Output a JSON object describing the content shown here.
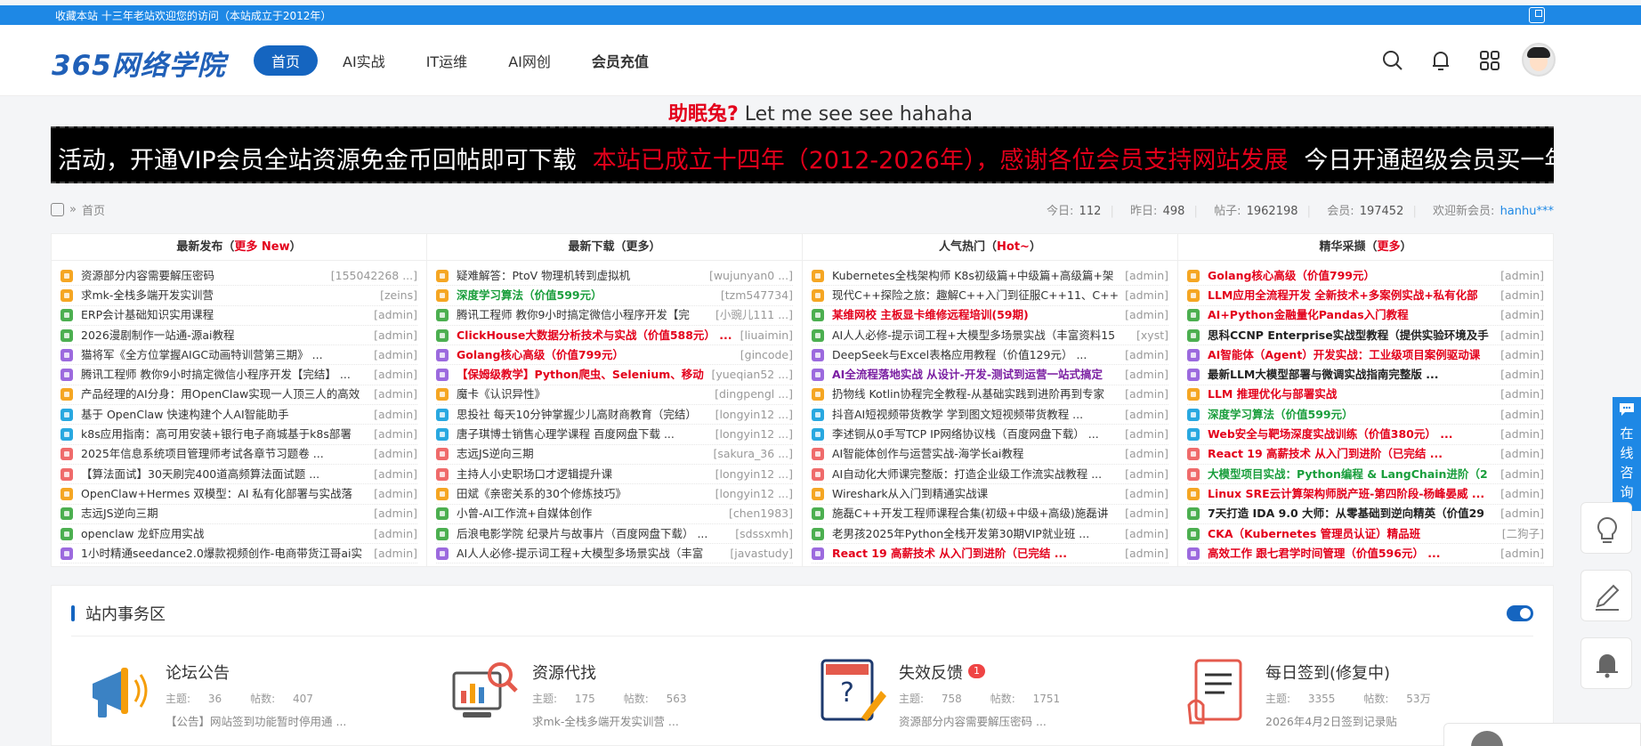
{
  "topbar": {
    "text": "收藏本站   十三年老站欢迎您的访问（本站成立于2012年）"
  },
  "header": {
    "logo": "365网络学院",
    "nav": [
      {
        "label": "首页"
      },
      {
        "label": "AI实战"
      },
      {
        "label": "IT运维"
      },
      {
        "label": "AI网创"
      },
      {
        "label": "会员充值"
      }
    ]
  },
  "slogan": {
    "red": "助眠兔?",
    "black": " Let me see see hahaha"
  },
  "marquee": {
    "part1": "活动，开通VIP会员全站资源免金币回帖即可下载",
    "part2": "本站已成立十四年（2012-2026年），感谢各位会员支持网站发展",
    "part3": "今日开通超级会员买一年送"
  },
  "crumb": {
    "home": "首页",
    "sep": "»"
  },
  "stats": {
    "today_label": "今日:",
    "today": "112",
    "yesterday_label": "昨日:",
    "yesterday": "498",
    "posts_label": "帖子:",
    "posts": "1962198",
    "members_label": "会员:",
    "members": "197452",
    "newuser_label": "欢迎新会员:",
    "newuser": "hanhu***"
  },
  "columns": [
    {
      "title": "最新发布（",
      "title_hl": "更多 New",
      "title_end": "）",
      "items": [
        {
          "t": "资源部分内容需要解压密码",
          "a": "[155042268 ...]",
          "style": ""
        },
        {
          "t": "求mk-全栈多端开发实训营",
          "a": "[zeins]",
          "style": ""
        },
        {
          "t": "ERP会计基础知识实用课程",
          "a": "[admin]",
          "style": ""
        },
        {
          "t": "2026漫剧制作一站通-源ai教程",
          "a": "[admin]",
          "style": ""
        },
        {
          "t": "猫将军《全方位掌握AIGC动画特训营第三期》 ...",
          "a": "[admin]",
          "style": ""
        },
        {
          "t": "腾讯工程师 教你9小时搞定微信小程序开发【完结】 ...",
          "a": "[admin]",
          "style": ""
        },
        {
          "t": "产品经理的AI分身：用OpenClaw实现一人顶三人的高效",
          "a": "[admin]",
          "style": ""
        },
        {
          "t": "基于 OpenClaw 快速构建个人AI智能助手",
          "a": "[admin]",
          "style": ""
        },
        {
          "t": "k8s应用指南：高可用安装+银行电子商城基于k8s部署",
          "a": "[admin]",
          "style": ""
        },
        {
          "t": "2025年信息系统项目管理师考试各章节习题卷 ...",
          "a": "[admin]",
          "style": ""
        },
        {
          "t": "【算法面试】30天刷完400道高频算法面试题 ...",
          "a": "[admin]",
          "style": ""
        },
        {
          "t": "OpenClaw+Hermes 双模型：AI 私有化部署与实战落",
          "a": "[admin]",
          "style": ""
        },
        {
          "t": "志远JS逆向三期",
          "a": "[admin]",
          "style": ""
        },
        {
          "t": "openclaw 龙虾应用实战",
          "a": "[admin]",
          "style": ""
        },
        {
          "t": "1小时精通seedance2.0爆款视频创作-电商带货江哥ai实",
          "a": "[admin]",
          "style": ""
        }
      ]
    },
    {
      "title": "最新下载（更多）",
      "title_hl": "",
      "title_end": "",
      "items": [
        {
          "t": "疑难解答：PtoV 物理机转到虚拟机",
          "a": "[wujunyan0 ...]",
          "style": ""
        },
        {
          "t": "深度学习算法（价值599元）",
          "a": "[tzm547734]",
          "style": "green"
        },
        {
          "t": "腾讯工程师 教你9小时搞定微信小程序开发【完",
          "a": "[小豌儿111 ...]",
          "style": ""
        },
        {
          "t": "ClickHouse大数据分析技术与实战（价值588元） ...",
          "a": "[liuaimin]",
          "style": "red"
        },
        {
          "t": "Golang核心高级（价值799元）",
          "a": "[gincode]",
          "style": "red"
        },
        {
          "t": "【保姆级教学】Python爬虫、Selenium、移动",
          "a": "[yueqian52 ...]",
          "style": "red"
        },
        {
          "t": "魔卡《认识异性》",
          "a": "[dingpengl ...]",
          "style": ""
        },
        {
          "t": "思投社 每天10分钟掌握少儿高财商教育（完结）",
          "a": "[longyin12 ...]",
          "style": ""
        },
        {
          "t": "唐子琪博士销售心理学课程 百度网盘下载 ...",
          "a": "[longyin12 ...]",
          "style": ""
        },
        {
          "t": "志远JS逆向三期",
          "a": "[sakura_36 ...]",
          "style": ""
        },
        {
          "t": "主持人小史职场口才逻辑提升课",
          "a": "[longyin12 ...]",
          "style": ""
        },
        {
          "t": "田斌《亲密关系的30个修炼技巧》",
          "a": "[longyin12 ...]",
          "style": ""
        },
        {
          "t": "小曾-AI工作流+自媒体创作",
          "a": "[chen1983]",
          "style": ""
        },
        {
          "t": "后浪电影学院 纪录片与故事片（百度网盘下载） ...",
          "a": "[sdssxmh]",
          "style": ""
        },
        {
          "t": "AI人人必修-提示词工程+大模型多场景实战（丰富",
          "a": "[javastudy]",
          "style": ""
        }
      ]
    },
    {
      "title": "人气热门（",
      "title_hl": "Hot~",
      "title_end": "）",
      "items": [
        {
          "t": "Kubernetes全栈架构师 K8s初级篇+中级篇+高级篇+架",
          "a": "[admin]",
          "style": ""
        },
        {
          "t": "现代C++探险之旅：趣解C++入门到征服C++11、C++",
          "a": "[admin]",
          "style": ""
        },
        {
          "t": "某维网校 主板显卡维修远程培训(59期)",
          "a": "[admin]",
          "style": "red"
        },
        {
          "t": "AI人人必修-提示词工程+大模型多场景实战（丰富资料15",
          "a": "[xyst]",
          "style": ""
        },
        {
          "t": "DeepSeek与Excel表格应用教程（价值129元） ...",
          "a": "[admin]",
          "style": ""
        },
        {
          "t": "AI全流程落地实战 从设计-开发-测试到运营一站式搞定",
          "a": "[admin]",
          "style": "purple"
        },
        {
          "t": "扔物线 Kotlin协程完全教程-从基础实践到进阶再到专家",
          "a": "[admin]",
          "style": ""
        },
        {
          "t": "抖音AI短视频带货教学 学到图文短视频带货教程 ...",
          "a": "[admin]",
          "style": ""
        },
        {
          "t": "李述铜从0手写TCP IP网络协议栈（百度网盘下载） ...",
          "a": "[admin]",
          "style": ""
        },
        {
          "t": "AI智能体创作与运营实战-海学长ai教程",
          "a": "[admin]",
          "style": ""
        },
        {
          "t": "AI自动化大师课完整版：打造企业级工作流实战教程 ...",
          "a": "[admin]",
          "style": ""
        },
        {
          "t": "Wireshark从入门到精通实战课",
          "a": "[admin]",
          "style": ""
        },
        {
          "t": "施磊C++开发工程师课程合集(初级+中级+高级)施磊讲",
          "a": "[admin]",
          "style": ""
        },
        {
          "t": "老男孩2025年Python全栈开发第30期VIP就业班 ...",
          "a": "[admin]",
          "style": ""
        },
        {
          "t": "React 19 高薪技术 从入门到进阶（已完结 ...",
          "a": "[admin]",
          "style": "red"
        }
      ]
    },
    {
      "title": "精华采撷（",
      "title_hl": "更多",
      "title_end": "）",
      "items": [
        {
          "t": "Golang核心高级（价值799元）",
          "a": "[admin]",
          "style": "red"
        },
        {
          "t": "LLM应用全流程开发 全新技术+多案例实战+私有化部",
          "a": "[admin]",
          "style": "red"
        },
        {
          "t": "AI+Python金融量化Pandas入门教程",
          "a": "[admin]",
          "style": "red"
        },
        {
          "t": "思科CCNP Enterprise实战型教程（提供实验环境及手",
          "a": "[admin]",
          "style": "black"
        },
        {
          "t": "AI智能体（Agent）开发实战：工业级项目案例驱动课",
          "a": "[admin]",
          "style": "red"
        },
        {
          "t": "最新LLM大模型部署与微调实战指南完整版 ...",
          "a": "[admin]",
          "style": "black"
        },
        {
          "t": "LLM 推理优化与部署实战",
          "a": "[admin]",
          "style": "red"
        },
        {
          "t": "深度学习算法（价值599元）",
          "a": "[admin]",
          "style": "green"
        },
        {
          "t": "Web安全与靶场深度实战训练（价值380元） ...",
          "a": "[admin]",
          "style": "red"
        },
        {
          "t": "React 19 高薪技术 从入门到进阶（已完结 ...",
          "a": "[admin]",
          "style": "red"
        },
        {
          "t": "大模型项目实战：Python编程 & LangChain进阶（2",
          "a": "[admin]",
          "style": "green"
        },
        {
          "t": "Linux SRE云计算架构师脱产班-第四阶段-杨峰晏威 ...",
          "a": "[admin]",
          "style": "red"
        },
        {
          "t": "7天打造 IDA 9.0 大师：从零基础到逆向精英（价值29",
          "a": "[admin]",
          "style": "black"
        },
        {
          "t": "CKA（Kubernetes 管理员认证）精品班",
          "a": "[二狗子]",
          "style": "red"
        },
        {
          "t": "高效工作 跟七君学时间管理（价值596元） ...",
          "a": "[admin]",
          "style": "red"
        }
      ]
    }
  ],
  "num_colors": [
    "#f5a623",
    "#f5a623",
    "#4caf50",
    "#4caf50",
    "#9c6ade",
    "#9c6ade",
    "#f5a623",
    "#29a8e0",
    "#29a8e0",
    "#ef6b6b",
    "#ef6b6b",
    "#f5a623",
    "#4caf50",
    "#4caf50",
    "#9c6ade"
  ],
  "affairs": {
    "title": "站内事务区",
    "forums": [
      {
        "name": "论坛公告",
        "badge": "",
        "topics_label": "主题:",
        "topics": "36",
        "posts_label": "帖数:",
        "posts": "407",
        "last": "【公告】网站签到功能暂时停用通 ...",
        "icon": "megaphone-icon"
      },
      {
        "name": "资源代找",
        "badge": "",
        "topics_label": "主题:",
        "topics": "175",
        "posts_label": "帖数:",
        "posts": "563",
        "last": "求mk-全栈多端开发实训营 ...",
        "icon": "chart-search-icon"
      },
      {
        "name": "失效反馈",
        "badge": "1",
        "topics_label": "主题:",
        "topics": "758",
        "posts_label": "帖数:",
        "posts": "1751",
        "last": "资源部分内容需要解压密码 ...",
        "icon": "feedback-icon"
      },
      {
        "name": "每日签到(修复中)",
        "badge": "",
        "topics_label": "主题:",
        "topics": "3355",
        "posts_label": "帖数:",
        "posts": "53万",
        "last": "2026年4月2日签到记录贴",
        "icon": "checkin-icon"
      }
    ]
  },
  "side": {
    "consult": "在线咨询"
  }
}
